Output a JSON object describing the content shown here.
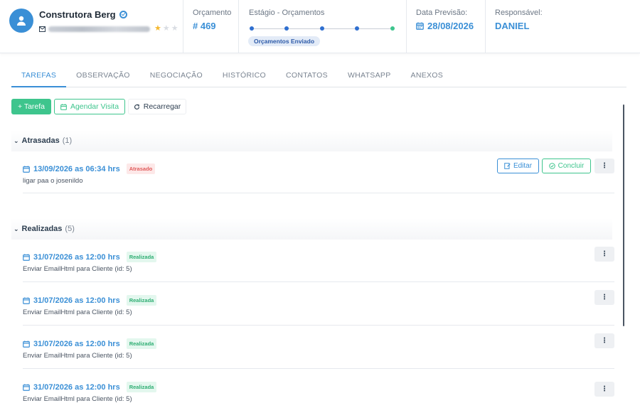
{
  "header": {
    "company_name": "Construtora Berg",
    "email_icon": "envelope-icon",
    "rating": 1,
    "rating_max": 3,
    "orcamento_label": "Orçamento",
    "orcamento_value": "# 469",
    "estagio_label": "Estágio - Orçamentos",
    "estagio_current": "Orçamentos Enviado",
    "data_previsao_label": "Data Previsão:",
    "data_previsao_value": "28/08/2026",
    "responsavel_label": "Responsável:",
    "responsavel_value": "DANIEL"
  },
  "tabs": [
    "TAREFAS",
    "OBSERVAÇÃO",
    "NEGOCIAÇÃO",
    "HISTÓRICO",
    "CONTATOS",
    "WHATSAPP",
    "ANEXOS"
  ],
  "toolbar": {
    "add_task": "+ Tarefa",
    "schedule_visit": "Agendar Visita",
    "reload": "Recarregar"
  },
  "sections": {
    "atrasadas": {
      "title": "Atrasadas",
      "count": "(1)",
      "tasks": [
        {
          "datetime": "13/09/2026 as 06:34 hrs",
          "status": "Atrasado",
          "description": "ligar paa o josenildo",
          "edit_label": "Editar",
          "conclude_label": "Concluir"
        }
      ]
    },
    "realizadas": {
      "title": "Realizadas",
      "count": "(5)",
      "tasks": [
        {
          "datetime": "31/07/2026 as 12:00 hrs",
          "status": "Realizada",
          "description": "Enviar EmailHtml para Cliente (id: 5)"
        },
        {
          "datetime": "31/07/2026 as 12:00 hrs",
          "status": "Realizada",
          "description": "Enviar EmailHtml para Cliente (id: 5)"
        },
        {
          "datetime": "31/07/2026 as 12:00 hrs",
          "status": "Realizada",
          "description": "Enviar EmailHtml para Cliente (id: 5)"
        },
        {
          "datetime": "31/07/2026 as 12:00 hrs",
          "status": "Realizada",
          "description": "Enviar EmailHtml para Cliente (id: 5)"
        }
      ]
    }
  },
  "colors": {
    "accent_blue": "#3a8fd6",
    "accent_green": "#3ec58d",
    "late_red": "#e05a5a"
  }
}
